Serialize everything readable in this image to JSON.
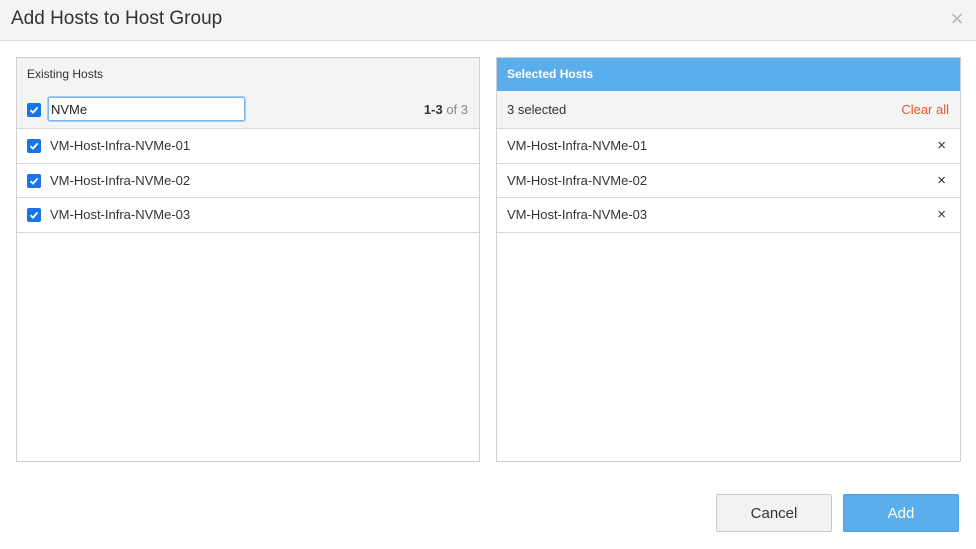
{
  "dialog": {
    "title": "Add Hosts to Host Group",
    "close_glyph": "×"
  },
  "existing": {
    "header": "Existing Hosts",
    "filter_value": "NVMe",
    "range_bold": "1-3",
    "range_rest": " of 3",
    "select_all_checked": true,
    "items": [
      {
        "label": "VM-Host-Infra-NVMe-01",
        "checked": true
      },
      {
        "label": "VM-Host-Infra-NVMe-02",
        "checked": true
      },
      {
        "label": "VM-Host-Infra-NVMe-03",
        "checked": true
      }
    ]
  },
  "selected": {
    "header": "Selected Hosts",
    "count_text": "3 selected",
    "clear_all": "Clear all",
    "remove_glyph": "×",
    "items": [
      {
        "label": "VM-Host-Infra-NVMe-01"
      },
      {
        "label": "VM-Host-Infra-NVMe-02"
      },
      {
        "label": "VM-Host-Infra-NVMe-03"
      }
    ]
  },
  "buttons": {
    "cancel": "Cancel",
    "add": "Add"
  },
  "colors": {
    "accent": "#5aaeeb",
    "checkbox": "#1a73e8",
    "clear_all": "#e8562a"
  }
}
